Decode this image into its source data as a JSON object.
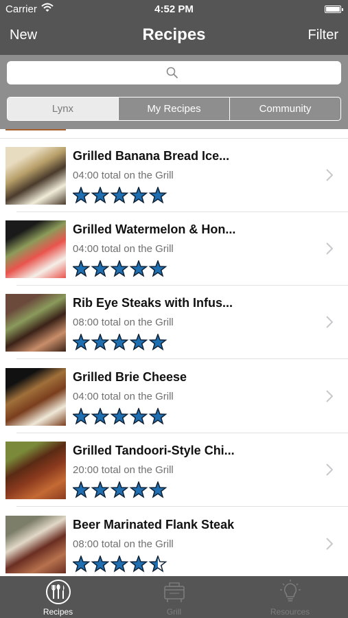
{
  "status_bar": {
    "carrier": "Carrier",
    "time": "4:52 PM"
  },
  "nav": {
    "left_button": "New",
    "title": "Recipes",
    "right_button": "Filter"
  },
  "search": {
    "placeholder": "",
    "icon": "search-icon"
  },
  "segments": [
    {
      "label": "Lynx",
      "selected": true
    },
    {
      "label": "My Recipes",
      "selected": false
    },
    {
      "label": "Community",
      "selected": false
    }
  ],
  "recipes": [
    {
      "name": "Grilled Banana Bread Ice...",
      "time": "04:00 total on the Grill",
      "rating": 5,
      "thumb_colors": [
        "#e8dcc0",
        "#4a3b2c",
        "#f1ecd9",
        "#b9a06a"
      ]
    },
    {
      "name": "Grilled Watermelon & Hon...",
      "time": "04:00 total on the Grill",
      "rating": 5,
      "thumb_colors": [
        "#1a1a1a",
        "#e9544d",
        "#f4efe8",
        "#8c9b5a"
      ]
    },
    {
      "name": "Rib Eye Steaks with Infus...",
      "time": "08:00 total on the Grill",
      "rating": 5,
      "thumb_colors": [
        "#6b4a3c",
        "#3b2218",
        "#c98e6a",
        "#8a9a5c"
      ]
    },
    {
      "name": "Grilled Brie Cheese",
      "time": "04:00 total on the Grill",
      "rating": 5,
      "thumb_colors": [
        "#111111",
        "#7a3e1e",
        "#efe8d8",
        "#a0703a"
      ]
    },
    {
      "name": "Grilled Tandoori-Style Chi...",
      "time": "20:00 total on the Grill",
      "rating": 5,
      "thumb_colors": [
        "#7a8a3a",
        "#8b3a1e",
        "#c46a34",
        "#5a2a14"
      ]
    },
    {
      "name": "Beer Marinated Flank Steak",
      "time": "08:00 total on the Grill",
      "rating": 4.5,
      "thumb_colors": [
        "#7d7e6a",
        "#6a2e22",
        "#b7724e",
        "#e2d8c8"
      ]
    }
  ],
  "tabs": [
    {
      "label": "Recipes",
      "icon": "fork-knife-icon",
      "active": true
    },
    {
      "label": "Grill",
      "icon": "grill-icon",
      "active": false
    },
    {
      "label": "Resources",
      "icon": "lightbulb-icon",
      "active": false
    }
  ],
  "colors": {
    "bar_bg": "#555555",
    "search_area_bg": "#8e8e8e",
    "star_fill": "#1f6fb0",
    "star_stroke": "#0d1f33"
  }
}
